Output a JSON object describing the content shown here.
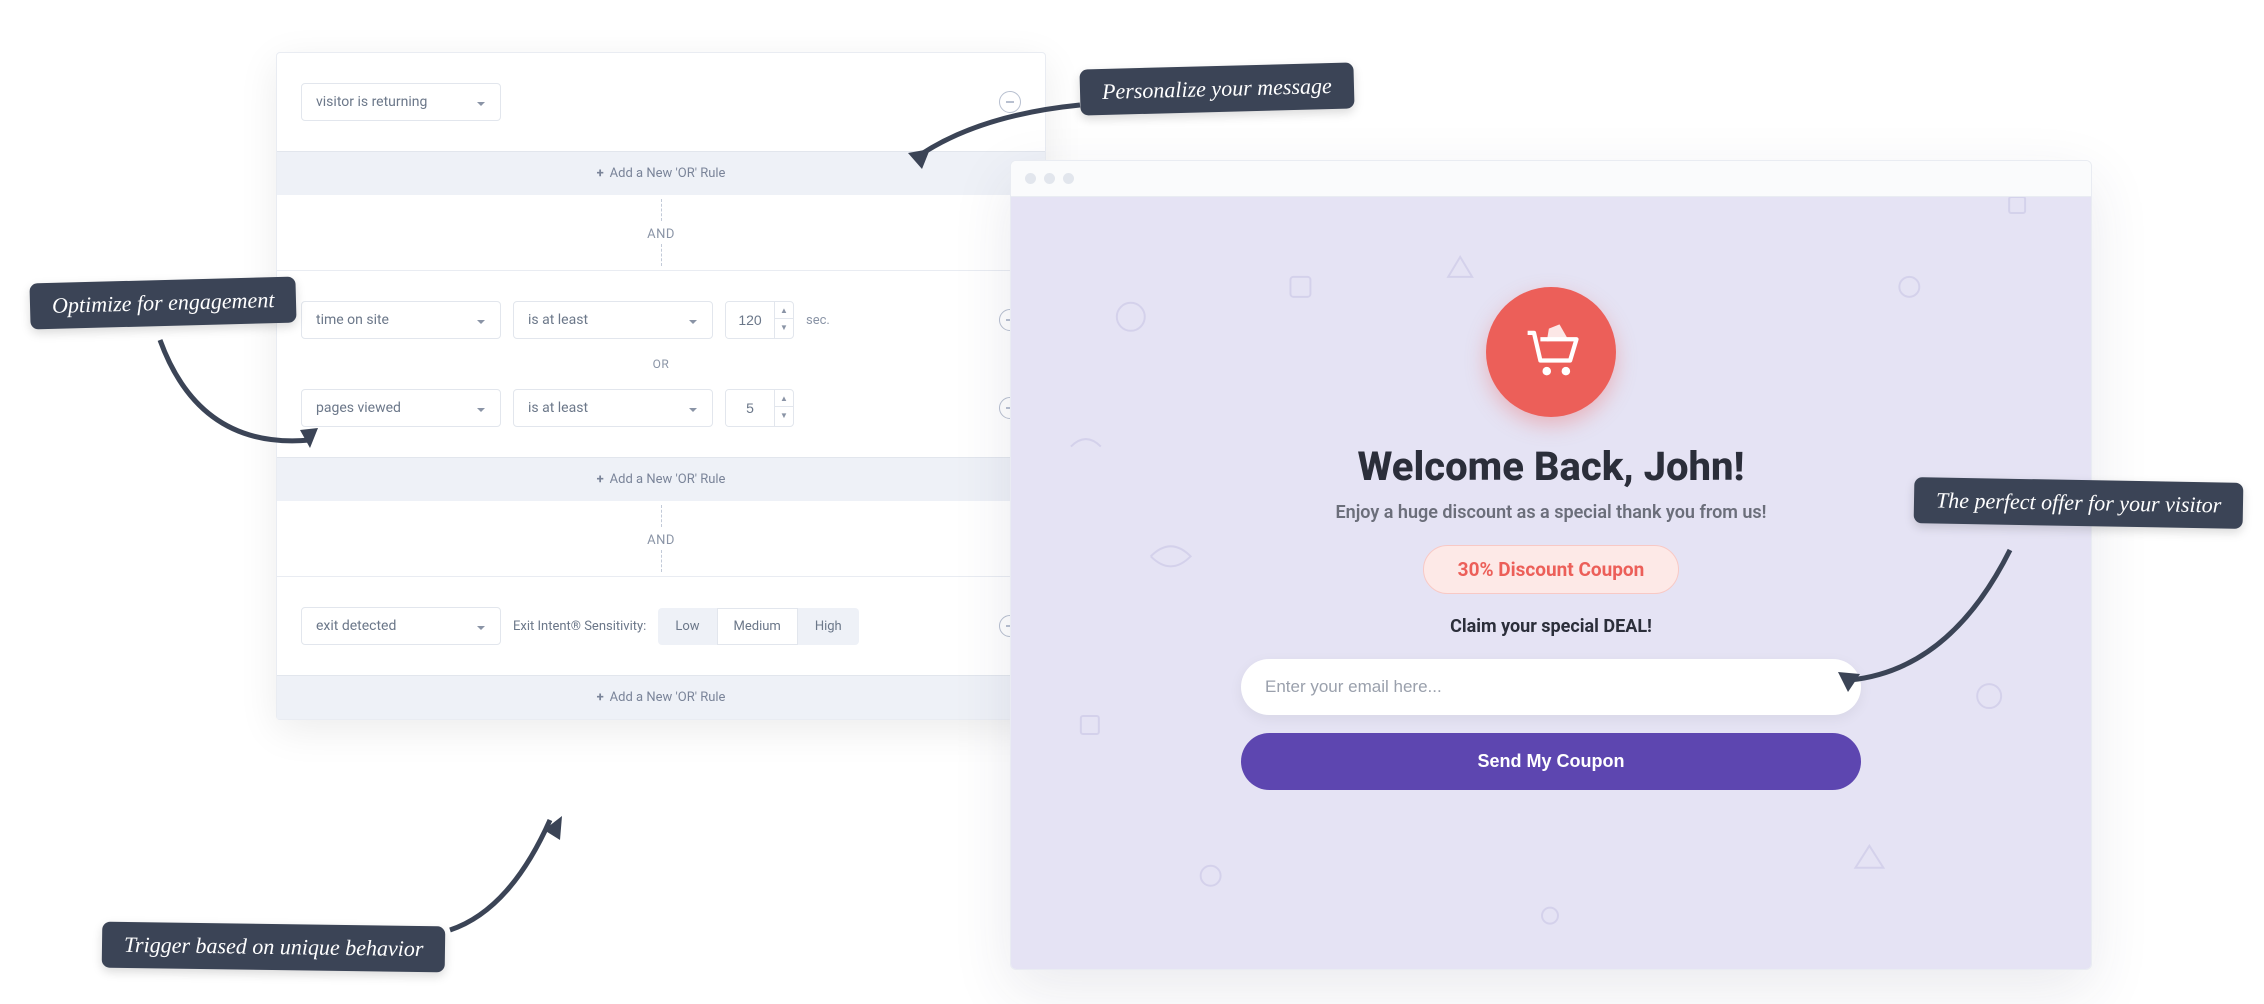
{
  "annotations": {
    "optimize": "Optimize for engagement",
    "personalize": "Personalize your message",
    "perfect_offer": "The perfect offer for your visitor",
    "trigger": "Trigger based on unique behavior"
  },
  "rules": {
    "block1": {
      "condition": "visitor is returning"
    },
    "add_or_label": "Add a New 'OR' Rule",
    "and_label": "AND",
    "or_label": "OR",
    "block2": {
      "row1": {
        "field": "time on site",
        "operator": "is at least",
        "value": "120",
        "unit": "sec."
      },
      "row2": {
        "field": "pages viewed",
        "operator": "is at least",
        "value": "5"
      }
    },
    "block3": {
      "field": "exit detected",
      "sensitivity_label": "Exit Intent® Sensitivity:",
      "options": {
        "low": "Low",
        "medium": "Medium",
        "high": "High"
      },
      "selected": "Medium"
    }
  },
  "preview": {
    "title": "Welcome Back, John!",
    "subtitle": "Enjoy a huge discount as a special thank you from us!",
    "coupon": "30% Discount Coupon",
    "claim": "Claim your special DEAL!",
    "email_placeholder": "Enter your email here...",
    "button": "Send My Coupon"
  }
}
